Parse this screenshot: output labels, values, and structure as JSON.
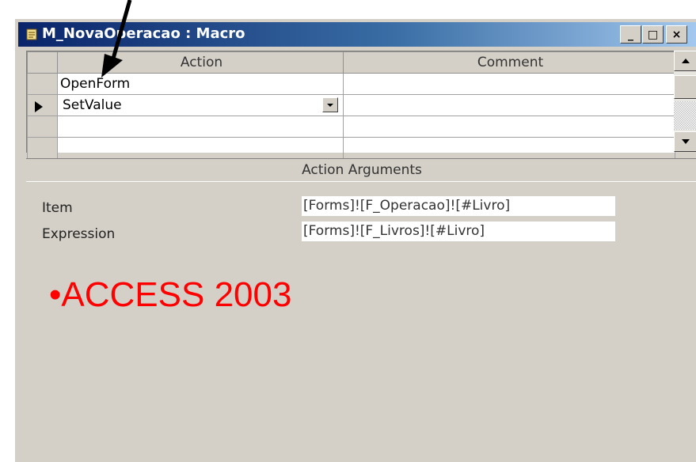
{
  "window": {
    "title": "M_NovaOperacao : Macro",
    "minimize_glyph": "_",
    "maximize_glyph": "□",
    "close_glyph": "×"
  },
  "grid": {
    "columns": [
      "Action",
      "Comment"
    ],
    "rows": [
      {
        "action": "OpenForm",
        "comment": ""
      },
      {
        "action": "SetValue",
        "comment": ""
      },
      {
        "action": "",
        "comment": ""
      },
      {
        "action": "",
        "comment": ""
      }
    ],
    "selected_row_indicator": "▶"
  },
  "arguments": {
    "header": "Action Arguments",
    "items": [
      {
        "label": "Item",
        "value": "[Forms]![F_Operacao]![#Livro]"
      },
      {
        "label": "Expression",
        "value": "[Forms]![F_Livros]![#Livro]"
      }
    ]
  },
  "caption": "•ACCESS 2003",
  "colors": {
    "titlebar_start": "#0a246a",
    "titlebar_end": "#a6caf0",
    "window_bg": "#d4d0c8",
    "caption": "#ff0000"
  },
  "icons": [
    "macro-icon",
    "record-selector-icon",
    "dropdown-arrow-icon",
    "scroll-up-icon",
    "scroll-down-icon",
    "annotation-arrow-icon"
  ]
}
